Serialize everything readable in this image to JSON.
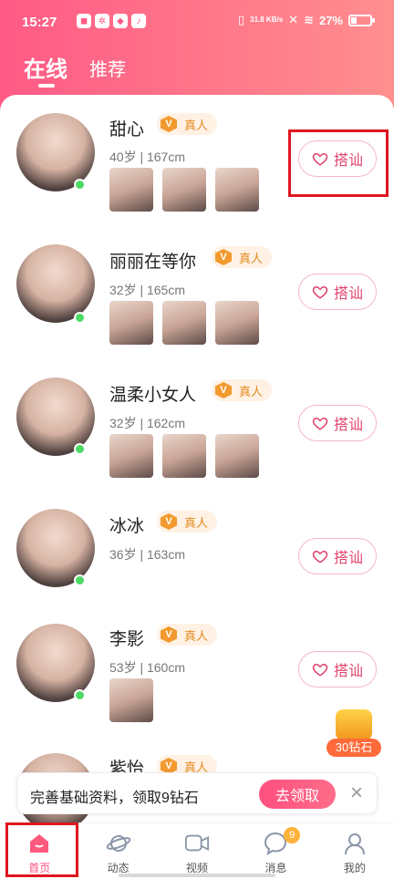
{
  "status": {
    "time": "15:27",
    "network_speed": "31.8 KB/s",
    "battery": "27%",
    "battery_level": 0.27
  },
  "tabs": [
    {
      "label": "在线"
    },
    {
      "label": "推荐"
    }
  ],
  "users": [
    {
      "name": "甜心",
      "verified": "真人",
      "info": "40岁 | 167cm",
      "action": "搭讪"
    },
    {
      "name": "丽丽在等你",
      "verified": "真人",
      "info": "32岁 | 165cm",
      "action": "搭讪"
    },
    {
      "name": "温柔小女人",
      "verified": "真人",
      "info": "32岁 | 162cm",
      "action": "搭讪"
    },
    {
      "name": "冰冰",
      "verified": "真人",
      "info": "36岁 | 163cm",
      "action": "搭讪"
    },
    {
      "name": "李影",
      "verified": "真人",
      "info": "53岁 | 160cm",
      "action": "搭讪"
    },
    {
      "name": "紫怡",
      "verified": "真人"
    }
  ],
  "reward": {
    "label": "30钻石"
  },
  "promo": {
    "text": "完善基础资料，领取9钻石",
    "button": "去领取"
  },
  "nav": [
    {
      "label": "首页",
      "icon": "home-icon"
    },
    {
      "label": "动态",
      "icon": "planet-icon"
    },
    {
      "label": "视频",
      "icon": "video-icon"
    },
    {
      "label": "消息",
      "icon": "message-icon",
      "badge": "9"
    },
    {
      "label": "我的",
      "icon": "profile-icon"
    }
  ],
  "colors": {
    "accent": "#ff4f7e",
    "header": "#ff5a86",
    "online": "#4cd964",
    "badge_bg": "#fff1e4"
  }
}
